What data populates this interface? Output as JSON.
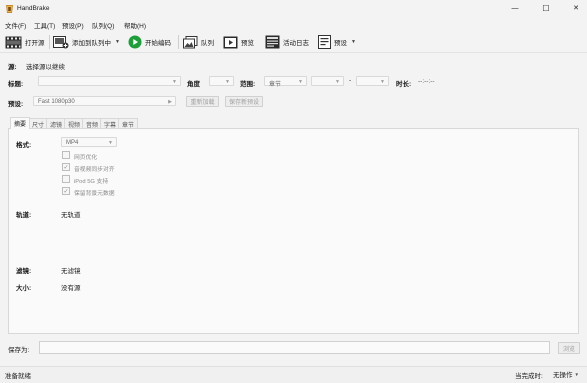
{
  "window": {
    "title": "HandBrake",
    "minimize_glyph": "—",
    "maximize_glyph": "☐",
    "close_glyph": "✕"
  },
  "menu": {
    "items": [
      "文件(F)",
      "工具(T)",
      "预设(P)",
      "队列(Q)",
      "帮助(H)"
    ]
  },
  "toolbar": {
    "open_source": "打开源",
    "add_to_queue": "添加到队列中",
    "start_encode": "开始编码",
    "queue": "队列",
    "preview": "预览",
    "activity_log": "活动日志",
    "presets": "预设"
  },
  "source": {
    "label": "源:",
    "value": "选择源以继续"
  },
  "title_row": {
    "title_label": "标题:",
    "angle_label": "角度",
    "range_label": "范围:",
    "range_value": "章节",
    "dash": "-",
    "duration_label": "时长:",
    "duration_value": "--:--:--"
  },
  "preset_row": {
    "label": "预设:",
    "value": "Fast 1080p30",
    "reload_button": "重新加载",
    "save_button": "保存新预设"
  },
  "tabs": [
    "摘要",
    "尺寸",
    "滤镜",
    "视频",
    "音频",
    "字幕",
    "章节"
  ],
  "summary": {
    "format_label": "格式:",
    "format_value": "MP4",
    "options": [
      {
        "label": "网页优化",
        "checked": false
      },
      {
        "label": "音视频同步对齐",
        "checked": true
      },
      {
        "label": "iPod 5G 支持",
        "checked": false
      },
      {
        "label": "保留背景元数据",
        "checked": true
      }
    ],
    "tracks_label": "轨道:",
    "tracks_value": "无轨道",
    "filters_label": "滤镜:",
    "filters_value": "无滤镜",
    "size_label": "大小:",
    "size_value": "没有源"
  },
  "save_as": {
    "label": "保存为:",
    "value": "",
    "browse_button": "浏览"
  },
  "status": {
    "left": "准备就绪",
    "when_done_label": "当完成时:",
    "when_done_value": "无操作"
  },
  "colors": {
    "accent_green": "#1e9e3a",
    "background": "#f3f3f3"
  }
}
